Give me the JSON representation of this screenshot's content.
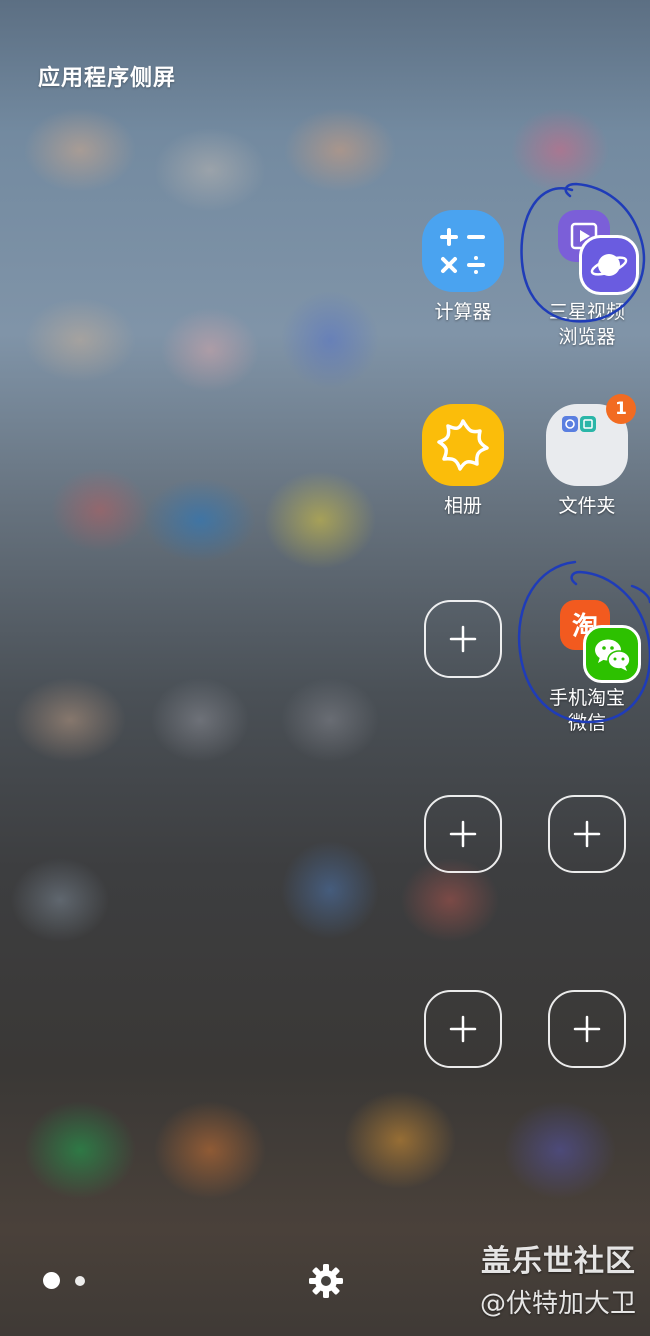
{
  "panel": {
    "title": "应用程序侧屏"
  },
  "apps": {
    "calculator": {
      "label": "计算器"
    },
    "pair_video_browser": {
      "label_line1": "三星视频",
      "label_line2": "浏览器"
    },
    "gallery": {
      "label": "相册"
    },
    "folder": {
      "label": "文件夹",
      "badge": "1"
    },
    "pair_taobao_wechat": {
      "label_line1": "手机淘宝",
      "label_line2": "微信",
      "taobao_glyph": "淘"
    }
  },
  "empty_slots": {
    "count": 5
  },
  "pager": {
    "pages": 2,
    "active_index": 0
  },
  "watermark": {
    "line1": "盖乐世社区",
    "line2": "@伏特加大卫"
  },
  "icons": {
    "calculator": "calculator-icon",
    "video": "samsung-video-icon",
    "browser": "samsung-internet-icon",
    "gallery": "gallery-flower-icon",
    "folder": "folder-icon",
    "taobao": "taobao-icon",
    "wechat": "wechat-icon",
    "add": "plus-icon",
    "settings": "gear-icon"
  },
  "colors": {
    "calculator_bg": "#4aa3f0",
    "video_bg": "#7b5fd8",
    "browser_bg": "#6a5ce0",
    "gallery_bg": "#fbbd0a",
    "folder_bg": "#e9ebee",
    "badge": "#f26b21",
    "taobao_bg": "#f25a1f",
    "wechat_bg": "#2dc100",
    "annotation_ink": "#1f3cb8"
  }
}
